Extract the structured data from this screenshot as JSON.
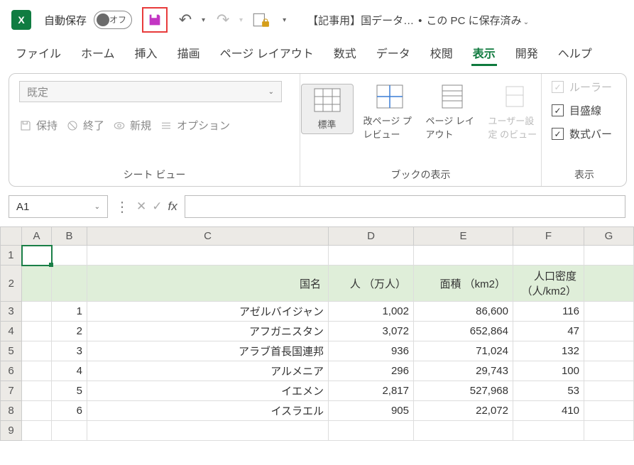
{
  "title": {
    "autoSave": "自動保存",
    "autoSaveState": "オフ",
    "docName": "【記事用】国データ…",
    "savedTo": "この PC に保存済み"
  },
  "tabs": [
    "ファイル",
    "ホーム",
    "挿入",
    "描画",
    "ページ レイアウト",
    "数式",
    "データ",
    "校閲",
    "表示",
    "開発",
    "ヘルプ"
  ],
  "activeTab": "表示",
  "sheetView": {
    "preset": "既定",
    "keep": "保持",
    "end": "終了",
    "new": "新規",
    "options": "オプション",
    "group": "シート ビュー"
  },
  "workbookViews": {
    "normal": "標準",
    "pbPreview": "改ページ プレビュー",
    "pageLayout": "ページ レイアウト",
    "custom": "ユーザー設定 のビュー",
    "group": "ブックの表示"
  },
  "show": {
    "ruler": "ルーラー",
    "gridlines": "目盛線",
    "formulaBar": "数式バー",
    "group": "表示"
  },
  "nameBox": "A1",
  "columns": [
    "",
    "A",
    "B",
    "C",
    "D",
    "E",
    "F",
    "G"
  ],
  "headerRow": {
    "c": "国名",
    "d": "人 （万人）",
    "e": "面積 （km2）",
    "f": "人口密度（人/km2）"
  },
  "rows": [
    {
      "r": 3,
      "b": "1",
      "c": "アゼルバイジャン",
      "d": "1,002",
      "e": "86,600",
      "f": "116"
    },
    {
      "r": 4,
      "b": "2",
      "c": "アフガニスタン",
      "d": "3,072",
      "e": "652,864",
      "f": "47"
    },
    {
      "r": 5,
      "b": "3",
      "c": "アラブ首長国連邦",
      "d": "936",
      "e": "71,024",
      "f": "132"
    },
    {
      "r": 6,
      "b": "4",
      "c": "アルメニア",
      "d": "296",
      "e": "29,743",
      "f": "100"
    },
    {
      "r": 7,
      "b": "5",
      "c": "イエメン",
      "d": "2,817",
      "e": "527,968",
      "f": "53"
    },
    {
      "r": 8,
      "b": "6",
      "c": "イスラエル",
      "d": "905",
      "e": "22,072",
      "f": "410"
    }
  ],
  "chart_data": {
    "type": "table",
    "title": "国データ",
    "columns": [
      "国名",
      "人（万人）",
      "面積（km2）",
      "人口密度（人/km2）"
    ],
    "rows": [
      [
        "アゼルバイジャン",
        1002,
        86600,
        116
      ],
      [
        "アフガニスタン",
        3072,
        652864,
        47
      ],
      [
        "アラブ首長国連邦",
        936,
        71024,
        132
      ],
      [
        "アルメニア",
        296,
        29743,
        100
      ],
      [
        "イエメン",
        2817,
        527968,
        53
      ],
      [
        "イスラエル",
        905,
        22072,
        410
      ]
    ]
  }
}
